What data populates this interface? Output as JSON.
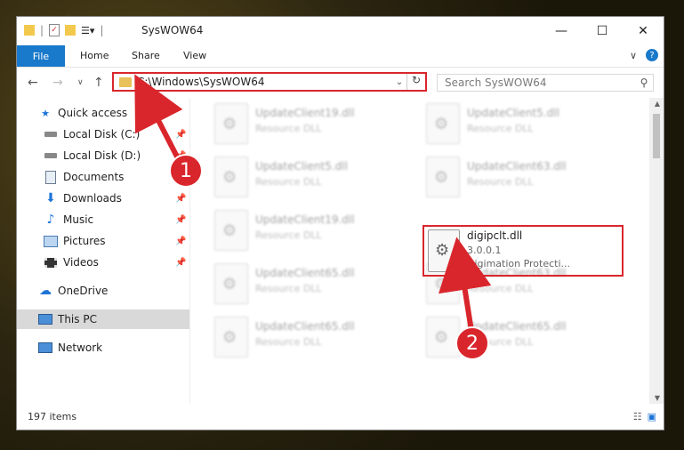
{
  "window": {
    "title": "SysWOW64",
    "min": "—",
    "max": "☐",
    "close": "✕"
  },
  "ribbon": {
    "tabs": [
      "File",
      "Home",
      "Share",
      "View"
    ],
    "expand": "∨",
    "help": "?"
  },
  "nav": {
    "back": "←",
    "forward": "→",
    "recent": "∨",
    "up": "↑",
    "address": "C:\\Windows\\SysWOW64",
    "search_placeholder": "Search SysWOW64"
  },
  "sidebar": {
    "items": [
      {
        "label": "Quick access",
        "icon": "star-icon"
      },
      {
        "label": "Local Disk (C:)",
        "icon": "drive-icon"
      },
      {
        "label": "Local Disk (D:)",
        "icon": "drive-icon"
      },
      {
        "label": "Documents",
        "icon": "documents-icon"
      },
      {
        "label": "Downloads",
        "icon": "downloads-icon"
      },
      {
        "label": "Music",
        "icon": "music-icon"
      },
      {
        "label": "Pictures",
        "icon": "pictures-icon"
      },
      {
        "label": "Videos",
        "icon": "videos-icon"
      },
      {
        "label": "OneDrive",
        "icon": "cloud-icon"
      },
      {
        "label": "This PC",
        "icon": "computer-icon"
      },
      {
        "label": "Network",
        "icon": "network-icon"
      }
    ]
  },
  "files": [
    {
      "name": "UpdateClient19.dll",
      "desc": "Resource DLL"
    },
    {
      "name": "UpdateClient5.dll",
      "desc": "Resource DLL"
    },
    {
      "name": "UpdateClient5.dll",
      "desc": "Resource DLL"
    },
    {
      "name": "UpdateClient63.dll",
      "desc": "Resource DLL"
    },
    {
      "name": "UpdateClient19.dll",
      "desc": "Resource DLL"
    },
    {
      "name": "UpdateClient65.dll",
      "desc": "Resource DLL"
    },
    {
      "name": "UpdateClient63.dll",
      "desc": "Resource DLL"
    },
    {
      "name": "UpdateClient65.dll",
      "desc": "Resource DLL"
    },
    {
      "name": "UpdateClient65.dll",
      "desc": "Resource DLL"
    }
  ],
  "target_file": {
    "name": "digipclt.dll",
    "version": "3.0.0.1",
    "desc": "Digimation Protecti..."
  },
  "status": {
    "count": "197 items"
  },
  "annotations": {
    "badge1": "1",
    "badge2": "2",
    "color": "#d9262c"
  }
}
